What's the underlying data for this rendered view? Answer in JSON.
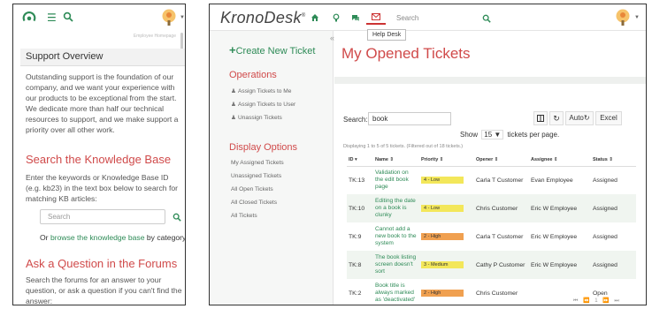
{
  "mobile": {
    "breadcrumb": "Employee Homepage",
    "support_overview": {
      "title": "Support Overview",
      "body": "Outstanding support is the foundation of our company, and we want your experience with our products to be exceptional from the start. We dedicate more than half our technical resources to support, and we make support a priority over all other work."
    },
    "knowledge_base": {
      "title": "Search the Knowledge Base",
      "body": "Enter the keywords or Knowledge Base ID (e.g. kb23) in the text box below to search for matching KB articles:",
      "search_placeholder": "Search",
      "or_text": "Or ",
      "browse_link": "browse the knowledge base",
      "by_category": " by category"
    },
    "forums": {
      "title": "Ask a Question in the Forums",
      "body": "Search the forums for an answer to your question, or ask a question if you can't find the answer:"
    }
  },
  "desktop": {
    "logo": "KronoDesk",
    "logo_mark": "®",
    "search_placeholder": "Search",
    "tooltip": "Help Desk",
    "sidebar": {
      "create_plus": "+",
      "create_label": "Create New Ticket",
      "collapse": "«",
      "operations_title": "Operations",
      "operations": [
        "Assign Tickets to Me",
        "Assign Tickets to User",
        "Unassign Tickets"
      ],
      "display_title": "Display Options",
      "display": [
        "My Assigned Tickets",
        "Unassigned Tickets",
        "All Open Tickets",
        "All Closed Tickets",
        "All Tickets"
      ]
    },
    "main": {
      "title": "My Opened Tickets",
      "search_label": "Search:",
      "search_value": "book",
      "auto_label": "Auto",
      "excel_label": "Excel",
      "show_pre": "Show",
      "show_value": "15",
      "show_post": "tickets per page.",
      "info": "Displaying 1 to 5 of 5 tickets. (Filtered out of 18 tickets.)",
      "columns": [
        "ID",
        "Name",
        "Priority",
        "Opener",
        "Assignee",
        "Status"
      ],
      "rows": [
        {
          "id": "TK:13",
          "name": "Validation on the edit book page",
          "priority": "4 - Low",
          "opener": "Carla T Customer",
          "assignee": "Evan Employee",
          "status": "Assigned"
        },
        {
          "id": "TK:10",
          "name": "Editing the date on a book is clunky",
          "priority": "4 - Low",
          "opener": "Chris Customer",
          "assignee": "Eric W Employee",
          "status": "Assigned"
        },
        {
          "id": "TK:9",
          "name": "Cannot add a new book to the system",
          "priority": "2 - High",
          "opener": "Carla T Customer",
          "assignee": "Eric W Employee",
          "status": "Assigned"
        },
        {
          "id": "TK:8",
          "name": "The book listing screen doesn't sort",
          "priority": "3 - Medium",
          "opener": "Cathy P Customer",
          "assignee": "Eric W Employee",
          "status": "Assigned"
        },
        {
          "id": "TK:2",
          "name": "Book title is always marked as 'deactivated'",
          "priority": "2 - High",
          "opener": "Chris Customer",
          "assignee": "",
          "status": "Open"
        }
      ],
      "pager": [
        "⏮",
        "⏪",
        "1",
        "⏩",
        "⏭"
      ]
    }
  },
  "colors": {
    "accent_green": "#2e8b57",
    "accent_red": "#d04a4a",
    "priority_low": "#f3e75a",
    "priority_high": "#f0a050"
  }
}
